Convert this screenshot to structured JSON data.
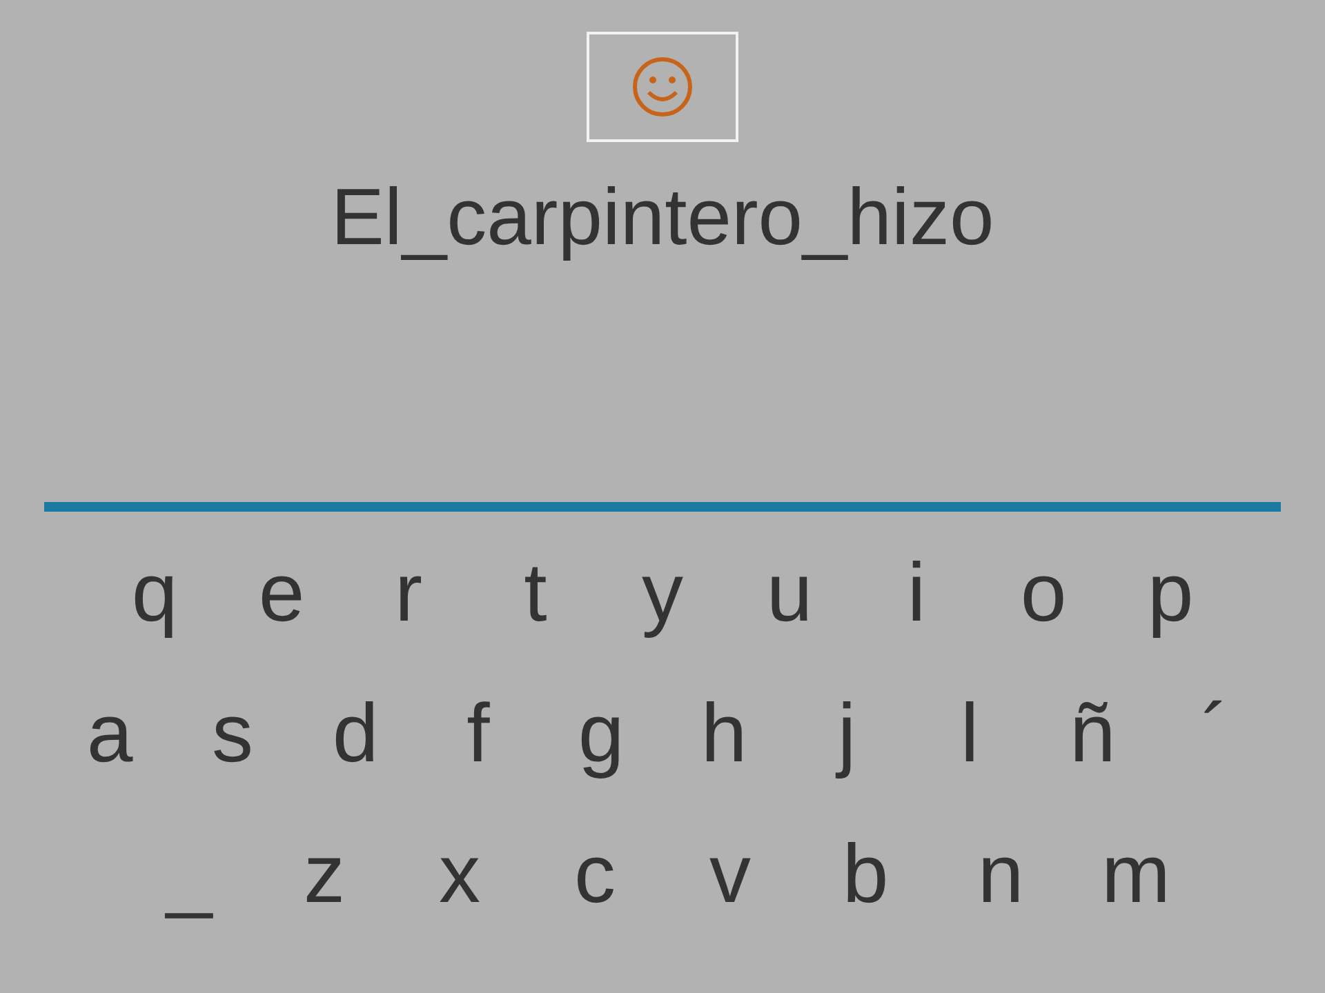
{
  "word": "El_carpintero_hizo",
  "keyboard": [
    {
      "keys": [
        "q",
        "e",
        "r",
        "t",
        "y",
        "u",
        "i",
        "o",
        "p"
      ]
    },
    {
      "keys": [
        "a",
        "s",
        "d",
        "f",
        "g",
        "h",
        "j",
        "l",
        "ñ",
        "´"
      ]
    },
    {
      "keys": [
        "_",
        "z",
        "x",
        "c",
        "v",
        "b",
        "n",
        "m"
      ]
    }
  ]
}
